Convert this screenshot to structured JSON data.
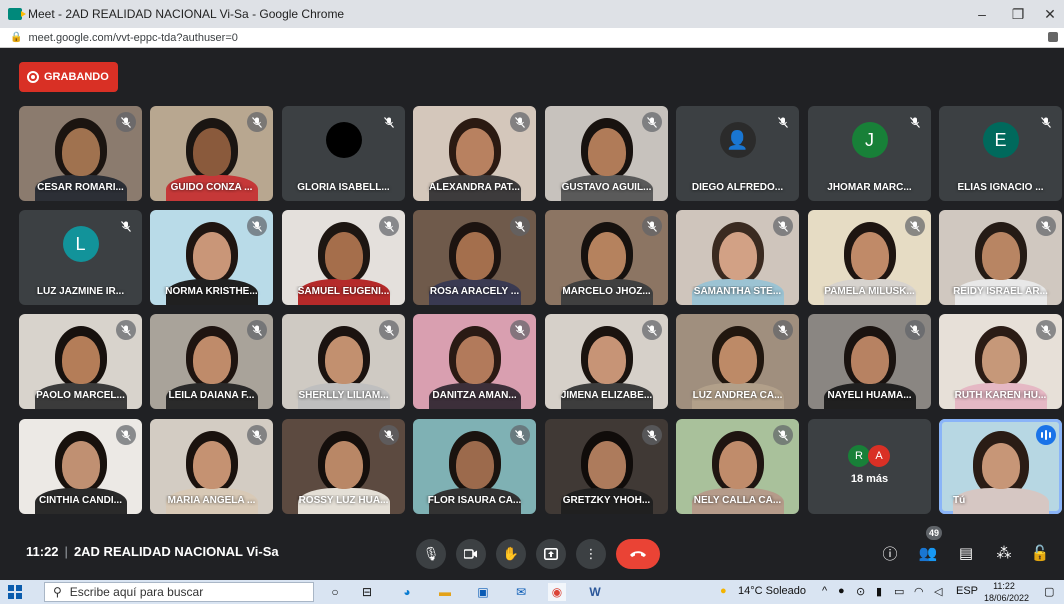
{
  "window": {
    "title": "Meet - 2AD REALIDAD NACIONAL Vi-Sa - Google Chrome",
    "url": "meet.google.com/vvt-eppc-tda?authuser=0",
    "min": "–",
    "restore": "❐",
    "close": "✕"
  },
  "recording": {
    "label": "GRABANDO"
  },
  "participants": [
    {
      "name": "CESAR ROMARI...",
      "kind": "video",
      "bg": "#8b7b6e",
      "skin": "#a0724f",
      "hair": "#1b1410",
      "shirt": "#2c2f36"
    },
    {
      "name": "GUIDO CONZA ...",
      "kind": "video",
      "bg": "#b8a790",
      "skin": "#8a5a3c",
      "hair": "#1a1512",
      "shirt": "#c53838"
    },
    {
      "name": "GLORIA ISABELL...",
      "kind": "avatar",
      "avatar_color": "#000000",
      "letter": ""
    },
    {
      "name": "ALEXANDRA PAT...",
      "kind": "video",
      "bg": "#d4c7bb",
      "skin": "#b88160",
      "hair": "#2b1a12",
      "shirt": "#3d3b3c"
    },
    {
      "name": "GUSTAVO AGUIL...",
      "kind": "video",
      "bg": "#c7c2bd",
      "skin": "#b07b58",
      "hair": "#18120f",
      "shirt": "#5a5a5a"
    },
    {
      "name": "DIEGO ALFREDO...",
      "kind": "avatar",
      "avatar_color": "#2b2b2b",
      "letter": "👤"
    },
    {
      "name": "JHOMAR MARC...",
      "kind": "avatar",
      "avatar_color": "#188038",
      "letter": "J"
    },
    {
      "name": "ELIAS IGNACIO ...",
      "kind": "avatar",
      "avatar_color": "#00695c",
      "letter": "E"
    },
    {
      "name": "LUZ JAZMINE IR...",
      "kind": "avatar",
      "avatar_color": "#12939a",
      "letter": "L"
    },
    {
      "name": "NORMA KRISTHE...",
      "kind": "video",
      "bg": "#b9dbe8",
      "skin": "#c99678",
      "hair": "#1f1511",
      "shirt": "#202020"
    },
    {
      "name": "SAMUEL EUGENI...",
      "kind": "video",
      "bg": "#e4e0dc",
      "skin": "#a56e4b",
      "hair": "#1d1612",
      "shirt": "#b52a2a"
    },
    {
      "name": "ROSA ARACELY ...",
      "kind": "video",
      "bg": "#6f5a4b",
      "skin": "#a46f4d",
      "hair": "#1c1310",
      "shirt": "#3a3a52"
    },
    {
      "name": "MARCELO JHOZ...",
      "kind": "video",
      "bg": "#8c7563",
      "skin": "#b5825e",
      "hair": "#16110e",
      "shirt": "#404040"
    },
    {
      "name": "SAMANTHA STE...",
      "kind": "video",
      "bg": "#cfc5bc",
      "skin": "#d2a185",
      "hair": "#3a2a20",
      "shirt": "#9cc3d3"
    },
    {
      "name": "PAMELA MILUSK...",
      "kind": "video",
      "bg": "#e6dcc4",
      "skin": "#c08a68",
      "hair": "#1e1511",
      "shirt": "#d7d3ce"
    },
    {
      "name": "REIDY ISRAEL AR...",
      "kind": "video",
      "bg": "#d0c8c0",
      "skin": "#b88563",
      "hair": "#251b15",
      "shirt": "#e8e8e8"
    },
    {
      "name": "PAOLO MARCEL...",
      "kind": "video",
      "bg": "#d8d3cc",
      "skin": "#b47d58",
      "hair": "#17110e",
      "shirt": "#3b3b3b"
    },
    {
      "name": "LEILA DAIANA F...",
      "kind": "video",
      "bg": "#a9a39a",
      "skin": "#bf8b6a",
      "hair": "#1e1410",
      "shirt": "#2a2a2a"
    },
    {
      "name": "SHERLLY LILIAM...",
      "kind": "video",
      "bg": "#cfcac3",
      "skin": "#c2906f",
      "hair": "#1b1310",
      "shirt": "#bfbfbf"
    },
    {
      "name": "DANITZA AMAN...",
      "kind": "video",
      "bg": "#d99fb0",
      "skin": "#b27a5b",
      "hair": "#2a1a14",
      "shirt": "#3c2f3a"
    },
    {
      "name": "JIMENA ELIZABE...",
      "kind": "video",
      "bg": "#d6d0c9",
      "skin": "#c79476",
      "hair": "#1a130f",
      "shirt": "#3d3d3d"
    },
    {
      "name": "LUZ ANDREA CA...",
      "kind": "video",
      "bg": "#a08f7e",
      "skin": "#bd8a67",
      "hair": "#21170f",
      "shirt": "#b2a08a"
    },
    {
      "name": "NAYELI HUAMA...",
      "kind": "video",
      "bg": "#8a8682",
      "skin": "#b78262",
      "hair": "#1a1310",
      "shirt": "#202020"
    },
    {
      "name": "RUTH KAREN HU...",
      "kind": "video",
      "bg": "#e7e0d8",
      "skin": "#c69879",
      "hair": "#2b1c15",
      "shirt": "#e5b8c4"
    },
    {
      "name": "CINTHIA CANDI...",
      "kind": "video",
      "bg": "#ece9e5",
      "skin": "#c09072",
      "hair": "#18110d",
      "shirt": "#2a2a2a"
    },
    {
      "name": "MARIA ANGELA ...",
      "kind": "video",
      "bg": "#d3ccc3",
      "skin": "#c59272",
      "hair": "#1a120e",
      "shirt": "#d8c9b6"
    },
    {
      "name": "ROSSY LUZ HUA...",
      "kind": "video",
      "bg": "#5c4a40",
      "skin": "#b98766",
      "hair": "#150f0c",
      "shirt": "#e4dfd6"
    },
    {
      "name": "FLOR ISAURA CA...",
      "kind": "video",
      "bg": "#7fb1b4",
      "skin": "#9c6a4c",
      "hair": "#1a130f",
      "shirt": "#333333"
    },
    {
      "name": "GRETZKY YHOH...",
      "kind": "video",
      "bg": "#403935",
      "skin": "#ad7b5c",
      "hair": "#100c0a",
      "shirt": "#202020"
    },
    {
      "name": "NELY CALLA CA...",
      "kind": "video",
      "bg": "#a9c19b",
      "skin": "#c08c6b",
      "hair": "#1f1511",
      "shirt": "#b59b8a"
    }
  ],
  "more_tile": {
    "count_label": "18 más",
    "avatars": [
      {
        "letter": "R",
        "color": "#188038"
      },
      {
        "letter": "A",
        "color": "#d93025"
      }
    ]
  },
  "self_tile": {
    "name": "Tú",
    "bg": "#b7d7e3",
    "skin": "#c79677",
    "hair": "#2a1c15",
    "shirt": "#d6c7c3"
  },
  "bottom": {
    "time": "11:22",
    "separator": "|",
    "meeting_name": "2AD REALIDAD NACIONAL Vi-Sa",
    "participants_badge": "49"
  },
  "taskbar": {
    "search_placeholder": "Escribe aquí para buscar",
    "weather": "14°C Soleado",
    "language": "ESP",
    "clock_time": "11:22",
    "clock_date": "18/06/2022"
  },
  "colors": {
    "meet_bg": "#202124",
    "tile_bg": "#3c4043",
    "record": "#d93025",
    "end_call": "#ea4335",
    "self_outline": "#8ab4f8"
  }
}
